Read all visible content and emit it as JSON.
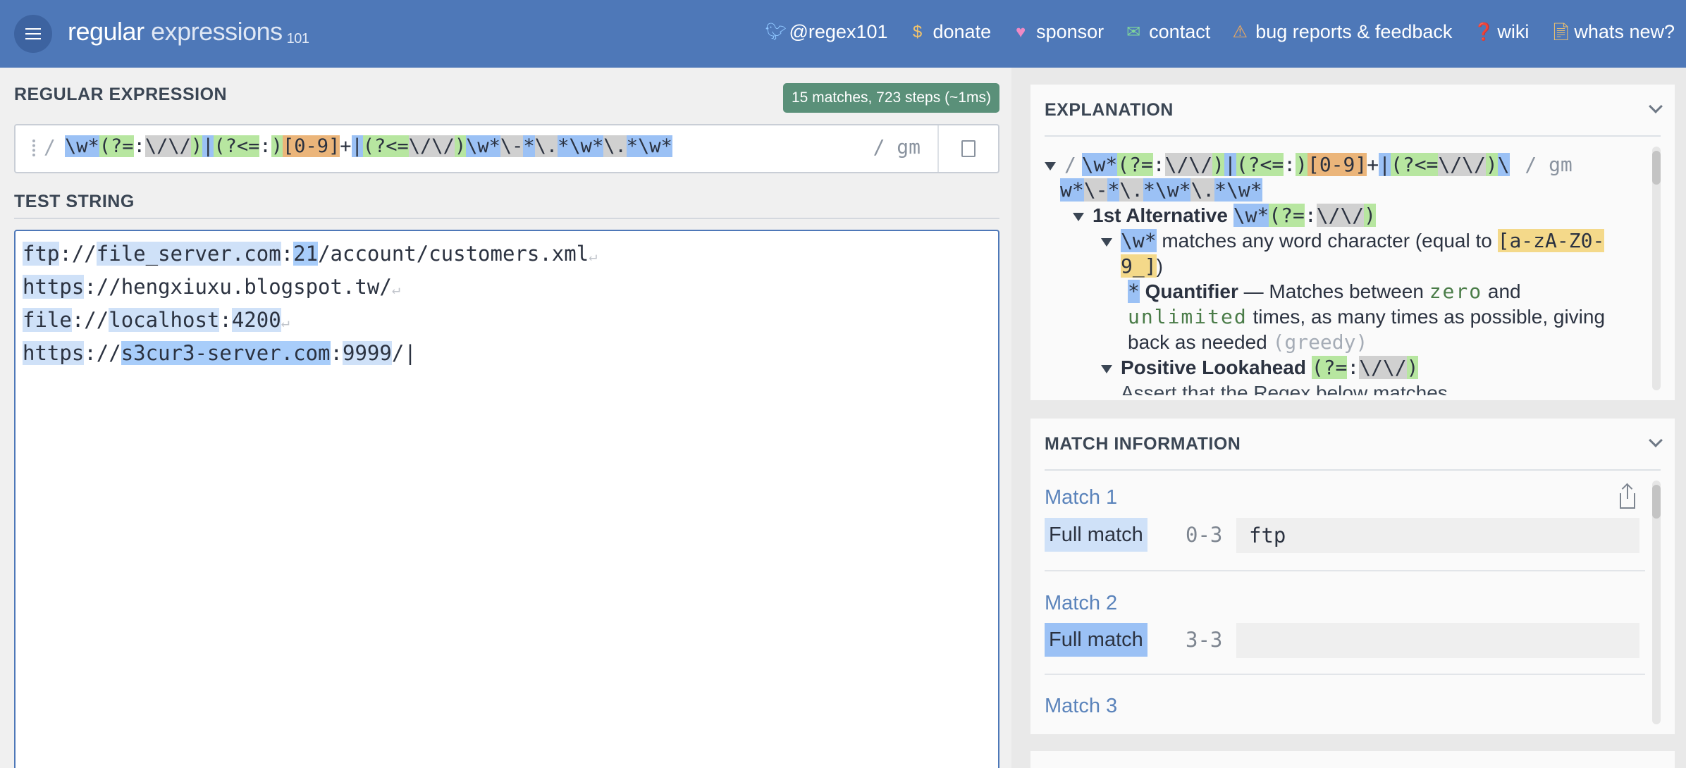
{
  "brand": {
    "name_bold": "regular",
    "name_light": " expressions",
    "version": "101"
  },
  "nav": [
    {
      "icon": "twitter-icon",
      "label": "@regex101"
    },
    {
      "icon": "dollar-icon",
      "label": "donate"
    },
    {
      "icon": "heart-icon",
      "label": "sponsor"
    },
    {
      "icon": "mail-icon",
      "label": "contact"
    },
    {
      "icon": "warning-icon",
      "label": "bug reports & feedback"
    },
    {
      "icon": "wiki-icon",
      "label": "wiki"
    },
    {
      "icon": "news-icon",
      "label": "whats new?"
    }
  ],
  "regex": {
    "section_label": "REGULAR EXPRESSION",
    "match_badge": "15 matches, 723 steps (~1ms)",
    "open_delim": "/",
    "pattern": "\\w*(?=:\\/\\/)|(?<=:)[0-9]+|(?<=\\/\\/)\\w*\\-*\\.*\\w*\\.*\\w*",
    "flags": "/ gm"
  },
  "test": {
    "section_label": "TEST STRING",
    "lines": [
      "ftp://file_server.com:21/account/customers.xml",
      "https://hengxiuxu.blogspot.tw/",
      "file://localhost:4200",
      "https://s3cur3-server.com:9999/"
    ]
  },
  "explanation": {
    "title": "EXPLANATION",
    "top_delim": "/",
    "top_flags": "/ gm",
    "alt1_label": "1st Alternative",
    "w_desc": "matches any word character (equal to",
    "class_text": "[a-zA-Z0-",
    "class_text2": "9_]",
    "quant_label": "Quantifier",
    "quant_desc1": "— Matches between",
    "zero": "zero",
    "and_word": "and",
    "unlimited": "unlimited",
    "quant_desc2": "times, as many times as possible, giving",
    "quant_desc3": "back as needed",
    "greedy": "(greedy)",
    "lookahead_label": "Positive Lookahead",
    "assert_text": "Assert that the Regex below matches"
  },
  "match_info": {
    "title": "MATCH INFORMATION",
    "matches": [
      {
        "title": "Match 1",
        "tag": "Full match",
        "range": "0-3",
        "value": "ftp"
      },
      {
        "title": "Match 2",
        "tag": "Full match",
        "range": "3-3",
        "value": ""
      },
      {
        "title": "Match 3"
      }
    ]
  },
  "colors": {
    "topbar": "#4e78b8",
    "badge": "#5a9079",
    "highlight_blue": "#9bc1f5",
    "highlight_light_blue": "#cfe1f8",
    "highlight_green": "#b7e6a0",
    "highlight_grey": "#d0d0d0",
    "highlight_orange": "#ebb57a",
    "highlight_yellow": "#f4d98a"
  }
}
